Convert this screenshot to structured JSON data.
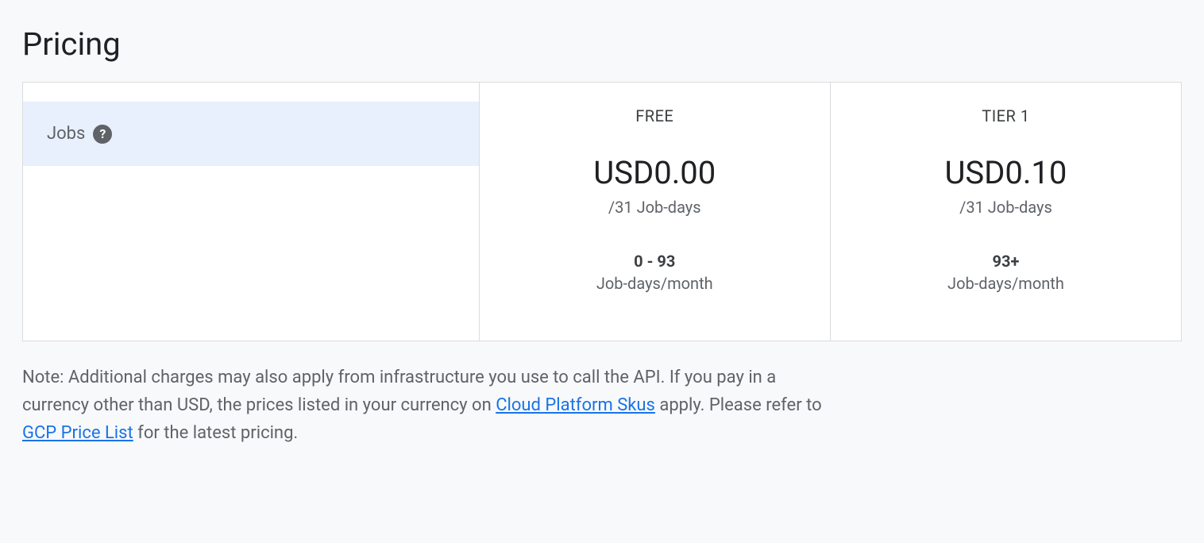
{
  "title": "Pricing",
  "rowHeader": "Jobs",
  "tiers": [
    {
      "name": "FREE",
      "price": "USD0.00",
      "unit": "/31 Job-days",
      "range": "0 - 93",
      "rangeUnit": "Job-days/month"
    },
    {
      "name": "TIER 1",
      "price": "USD0.10",
      "unit": "/31 Job-days",
      "range": "93+",
      "rangeUnit": "Job-days/month"
    }
  ],
  "note": {
    "part1": "Note: Additional charges may also apply from infrastructure you use to call the API. If you pay in a currency other than USD, the prices listed in your currency on ",
    "link1": "Cloud Platform Skus",
    "part2": " apply. Please refer to ",
    "link2": "GCP Price List",
    "part3": " for the latest pricing."
  }
}
